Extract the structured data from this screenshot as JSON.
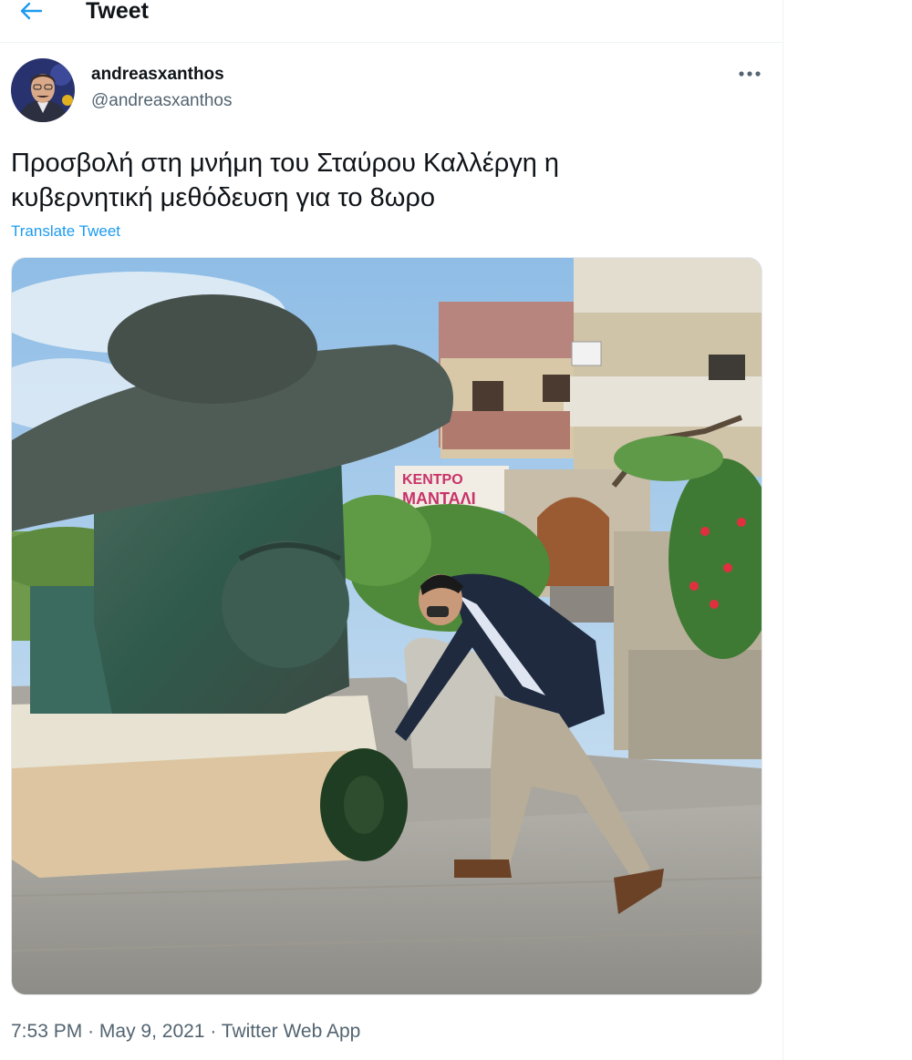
{
  "header": {
    "title": "Tweet",
    "back_icon": "arrow-left-icon",
    "accent": "#1d9bf0"
  },
  "author": {
    "display_name": "andreasxanthos",
    "handle": "@andreasxanthos"
  },
  "tweet": {
    "text_line1": "Προσβολή στη μνήμη του Σταύρου Καλλέργη η",
    "text_line2": "κυβερνητική μεθόδευση για το 8ωρο",
    "translate_label": "Translate Tweet",
    "more_icon": "more-horizontal-icon",
    "sign_text": "ΚΕΝΤΡΟ ΜΑΝΤΑΛΙ",
    "time": "7:53 PM",
    "date": "May 9, 2021",
    "source": "Twitter Web App",
    "separator": "·"
  }
}
